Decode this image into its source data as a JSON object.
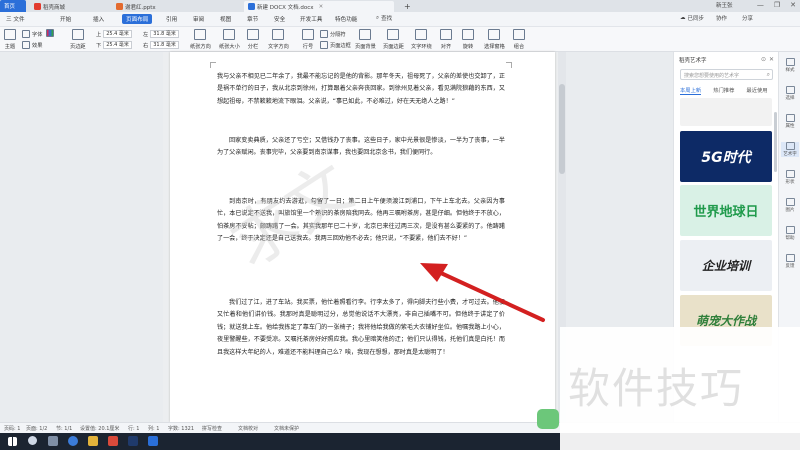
{
  "tabs": [
    {
      "label": "首页",
      "color": "#2b6fd9",
      "icon": "home-icon"
    },
    {
      "label": "稻壳商城",
      "color": "#e23b2e",
      "icon": "shop-icon"
    },
    {
      "label": "谢君红.pptx",
      "color": "#e36a2e",
      "icon": "ppt-icon"
    },
    {
      "label": "新建 DOCX 文档.docx",
      "color": "#2b6fd9",
      "icon": "doc-icon"
    },
    {
      "label": "+",
      "icon": "plus-icon"
    }
  ],
  "window": {
    "minimize": "—",
    "maximize": "❐",
    "close": "✕"
  },
  "menu": {
    "file": "三 文件",
    "items": [
      "开始",
      "插入",
      "页面布局",
      "引用",
      "审阅",
      "视图",
      "章节",
      "安全",
      "开发工具",
      "特色功能"
    ],
    "active_index": 2,
    "search": "查找",
    "sync": "已同步",
    "collab": "协作",
    "share": "分享",
    "user": "新王张"
  },
  "toolbar": {
    "theme": "主题",
    "font": "字体",
    "effect": "效果",
    "margins": "页边距",
    "top_label": "上",
    "top_value": "25.4 毫米",
    "bottom_label": "下",
    "bottom_value": "25.4 毫米",
    "left_label": "左",
    "left_value": "31.8 毫米",
    "right_label": "右",
    "right_value": "31.8 毫米",
    "orientation": "纸张方向",
    "size": "纸张大小",
    "columns": "分栏",
    "text_dir": "文字方向",
    "line_num": "行号",
    "page_break": "分隔符",
    "page_border": "页面边框",
    "page_bg": "页面背景",
    "page_margin": "页面边距",
    "wrap": "文字环绕",
    "align": "对齐",
    "rotate": "旋转",
    "select_pane": "选择窗格",
    "group": "组合"
  },
  "document": {
    "paragraphs": [
      "我与父亲不相见已二年余了，我最不能忘记的是他的背影。那年冬天，祖母死了，父亲的差使也交卸了，正是祸不单行的日子，我从北京到徐州，打算跟着父亲奔丧回家。到徐州见着父亲，看见满院狼藉的东西，又想起祖母，不禁簌簌地流下眼泪。父亲说，“事已如此，不必难过，好在天无绝人之路！”",
      "回家变卖典质，父亲还了亏空；又借钱办了丧事。这些日子，家中光景很是惨淡，一半为了丧事，一半为了父亲赋闲。丧事完毕，父亲要到南京谋事，我也要回北京念书，我们便同行。",
      "到南京时，有朋友约去游逛，勾留了一日；第二日上午便须渡江到浦口，下午上车北去。父亲因为事忙，本已说定不送我，叫旅馆里一个熟识的茶房陪我同去。他再三嘱咐茶房，甚是仔细。但他终于不放心，怕茶房不妥帖；颇踌躇了一会。其实我那年已二十岁，北京已来往过两三次，是没有甚么要紧的了。他踌躇了一会，终于决定还是自己送我去。我两三回劝他不必去；他只说，“不要紧，他们去不好！”",
      "我们过了江，进了车站。我买票，他忙着照看行李。行李太多了，得向脚夫行些小费，才可过去。他便又忙着和他们讲价钱。我那时真是聪明过分，总觉他说话不大漂亮，非自己插嘴不可。但他终于讲定了价钱；就送我上车。他给我拣定了靠车门的一张椅子；我将他给我做的紫毛大衣铺好坐位。他嘱我路上小心，夜里警醒些，不要受凉。又嘱托茶房好好照应我。我心里暗笑他的迂；他们只认得钱，托他们真是白托！而且我这样大年纪的人，难道还不能料理自己么？唉，我现在想想，那时真是太聪明了！"
    ],
    "stamp": "求文"
  },
  "right_panel": {
    "title": "稻壳艺术字",
    "search_placeholder": "搜索您想要使用的艺术字",
    "tabs": [
      "本周上新",
      "热门推荐",
      "最近使用"
    ],
    "cards": [
      {
        "text": "",
        "bg": "#f2f2f2",
        "color": "#ccc"
      },
      {
        "text": "5G时代",
        "bg": "#0d2a66",
        "color": "#ffffff"
      },
      {
        "text": "世界地球日",
        "bg": "#d9f1e6",
        "color": "#1f9a4b"
      },
      {
        "text": "企业培训",
        "bg": "#eceff3",
        "color": "#222222"
      },
      {
        "text": "萌宠大作战",
        "bg": "#e9e1c9",
        "color": "#2f7f3a"
      }
    ]
  },
  "side_strip": [
    "样式",
    "选择",
    "属性",
    "艺术字",
    "形状",
    "图片",
    "帮助",
    "反馈"
  ],
  "status": {
    "page": "页码: 1",
    "pages": "页面: 1/2",
    "section": "节: 1/1",
    "position": "设置值: 20.1厘米",
    "line": "行: 1",
    "col": "列: 1",
    "words": "字数: 1321",
    "spell": "拼写检查",
    "check": "文档校对",
    "protect": "文档未保护"
  },
  "watermark": "软件技巧",
  "annotation_color": "#d32020"
}
